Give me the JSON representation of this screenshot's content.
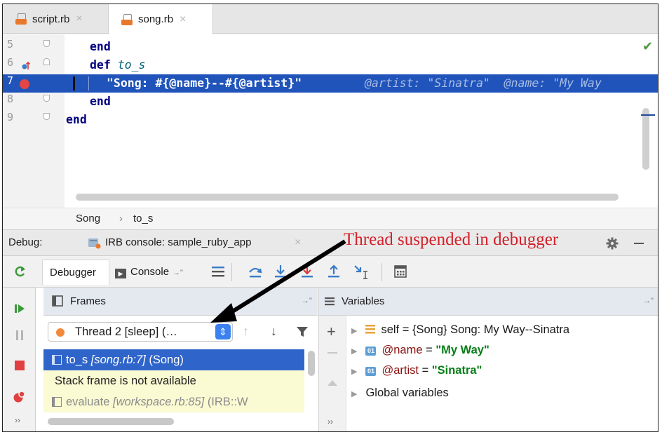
{
  "tabs": [
    {
      "label": "script.rb",
      "close": "×"
    },
    {
      "label": "song.rb",
      "close": "×"
    }
  ],
  "editor": {
    "lines": [
      {
        "num": "5",
        "indent": "  ",
        "kw": "end",
        "rest": ""
      },
      {
        "num": "6",
        "indent": "  ",
        "kw": "def",
        "rest": "to_s"
      },
      {
        "num": "7",
        "indent": "    ",
        "kw": "",
        "rest": "\"Song: #{@name}--#{@artist}\""
      },
      {
        "num": "8",
        "indent": "  ",
        "kw": "end",
        "rest": ""
      },
      {
        "num": "9",
        "indent": "",
        "kw": "end",
        "rest": ""
      }
    ],
    "inline_hints": "@artist: \"Sinatra\"  @name: \"My Way"
  },
  "breadcrumb": {
    "class": "Song",
    "sep": "›",
    "method": "to_s"
  },
  "debug": {
    "label": "Debug:",
    "session_tab": "IRB console: sample_ruby_app",
    "close": "×",
    "annotation": "Thread suspended in debugger",
    "toolbar": {
      "debugger_tab": "Debugger",
      "console_tab": "Console"
    }
  },
  "frames": {
    "title": "Frames",
    "thread": "Thread 2 [sleep] (…",
    "rows": [
      {
        "method": "to_s",
        "location": "[song.rb:7]",
        "owner": "(Song)"
      },
      {
        "text": "Stack frame is not available"
      },
      {
        "method": "evaluate",
        "location": "[workspace.rb:85]",
        "owner": "(IRB::W"
      }
    ]
  },
  "variables": {
    "title": "Variables",
    "rows": [
      {
        "name": "self",
        "eq": " = ",
        "value": "{Song} Song: My Way--Sinatra"
      },
      {
        "name": "@name",
        "eq": " = ",
        "value": "\"My Way\""
      },
      {
        "name": "@artist",
        "eq": " = ",
        "value": "\"Sinatra\""
      },
      {
        "name": "Global variables"
      }
    ]
  },
  "icons": [
    "file-ruby-icon",
    "close-icon",
    "breakpoint-icon",
    "rerun-icon",
    "resume-icon",
    "pause-icon",
    "stop-icon",
    "mute-breakpoints-icon",
    "gear-icon",
    "minimize-icon",
    "step-over-icon",
    "step-into-icon",
    "step-out-icon",
    "evaluate-icon",
    "filter-icon",
    "add-watch-icon"
  ],
  "colors": {
    "selection": "#2154ba",
    "frame_selected": "#2f65ca",
    "annotation": "#d4202a",
    "string_value": "#067d17"
  }
}
